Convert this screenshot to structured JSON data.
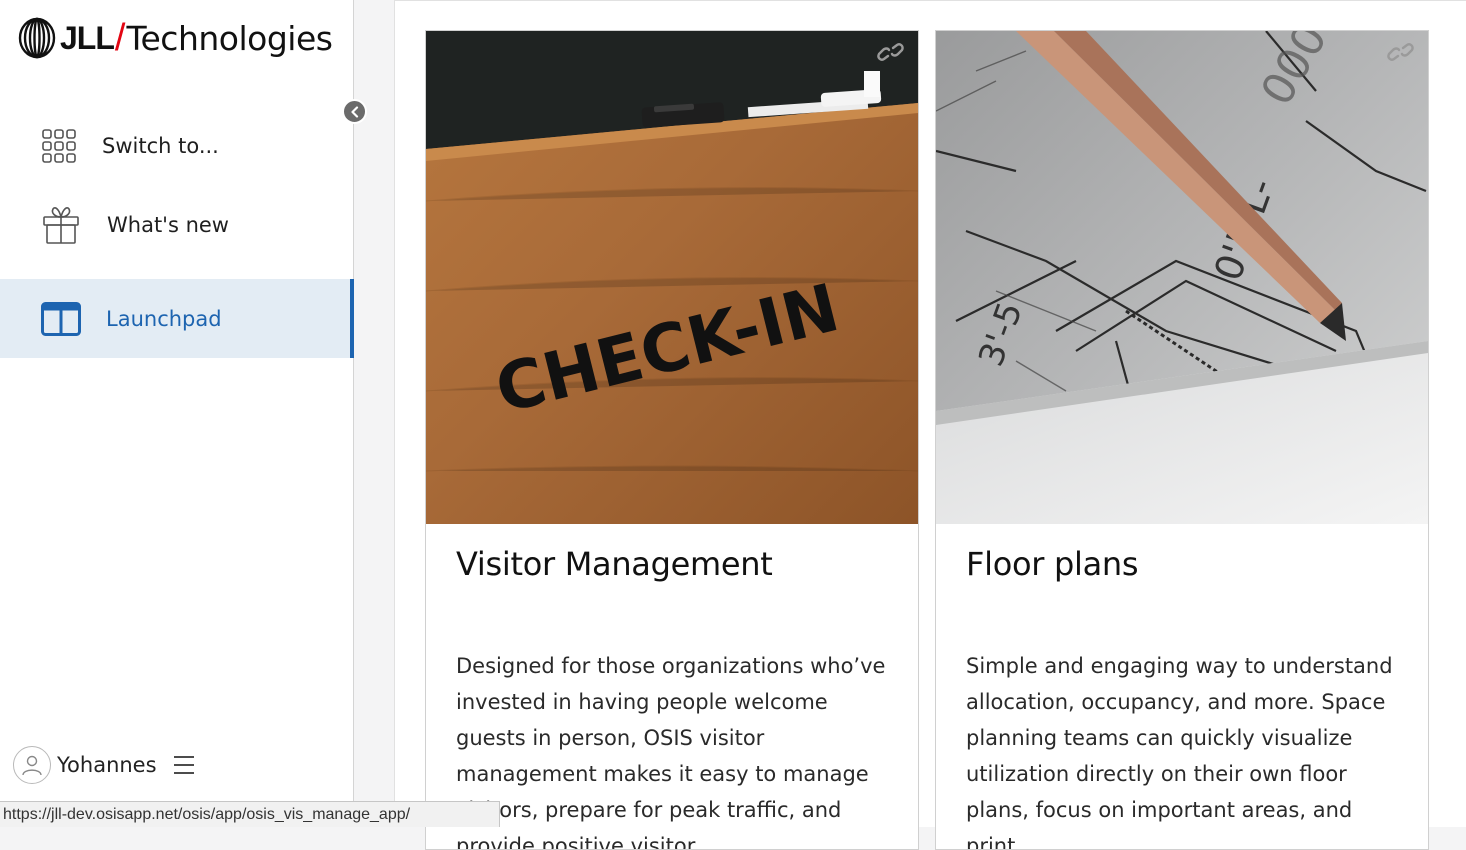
{
  "brand": {
    "primary": "JLL",
    "secondary": "Technologies",
    "accent_color": "#e30613"
  },
  "sidebar": {
    "items": [
      {
        "label": "Switch to...",
        "icon": "grid-icon"
      },
      {
        "label": "What's new",
        "icon": "gift-icon"
      },
      {
        "label": "Launchpad",
        "icon": "layout-icon",
        "active": true
      }
    ],
    "active_color": "#1d64b0",
    "user": {
      "name": "Yohannes"
    }
  },
  "status_bar": {
    "url": "https://jll-dev.osisapp.net/osis/app/osis_vis_manage_app/"
  },
  "cards": [
    {
      "title": "Visitor Management",
      "description": "Designed for those organizations who’ve invested in having people welcome guests in person, OSIS visitor management makes it easy to manage visitors, prepare for peak traffic, and provide positive visitor",
      "image_text": "CHECK-IN",
      "image_alt": "wooden check-in desk",
      "icon": "link-icon"
    },
    {
      "title": "Floor plans",
      "description": "Simple and engaging way to understand allocation, occupancy, and more. Space planning teams can quickly visualize utilization directly on their own floor plans, focus on important areas, and print",
      "image_alt": "pencil on architectural blueprint",
      "icon": "link-icon"
    }
  ]
}
